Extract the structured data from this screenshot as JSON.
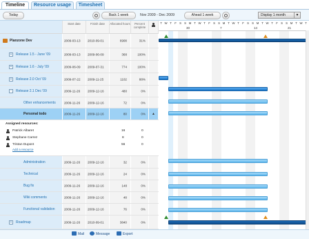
{
  "tabs": [
    {
      "label": "Timeline"
    },
    {
      "label": "Resource usage"
    },
    {
      "label": "Timesheet"
    }
  ],
  "toolbar": {
    "today": "Today",
    "back": "Back 1 week",
    "period": "Nov 2009 - Dec 2009",
    "ahead": "Ahead 1 week",
    "display": "Display 1 month"
  },
  "headers": {
    "start": "Start date",
    "finish": "Finish date",
    "allocated": "Allocated hours",
    "percent": "Percent complete"
  },
  "timeline": {
    "days": [
      "T",
      "W",
      "T",
      "F",
      "S",
      "S",
      "M",
      "T",
      "W",
      "T",
      "F",
      "S",
      "S",
      "M",
      "T",
      "W",
      "T",
      "F",
      "S",
      "S",
      "M",
      "T",
      "W",
      "T",
      "F",
      "S",
      "S",
      "M",
      "T",
      "W",
      "T"
    ],
    "weeks": [
      "30",
      "7",
      "14",
      "21"
    ]
  },
  "rows": [
    {
      "name": "Planzone Dev",
      "start": "2009-03-13",
      "finish": "2010-09-01",
      "hours": "6908",
      "pct": "31%"
    },
    {
      "name": "Release 1.5 - June '09",
      "start": "2009-03-13",
      "finish": "2009-06-09",
      "hours": "368",
      "pct": "100%"
    },
    {
      "name": "Release 1.6 - July '09",
      "start": "2009-06-09",
      "finish": "2009-07-31",
      "hours": "774",
      "pct": "100%"
    },
    {
      "name": "Release 2.0 Oct '09",
      "start": "2009-07-22",
      "finish": "2009-11-25",
      "hours": "1102",
      "pct": "88%"
    },
    {
      "name": "Release 2.1 Dec '09",
      "start": "2009-11-26",
      "finish": "2009-12-16",
      "hours": "480",
      "pct": "0%"
    },
    {
      "name": "Other enhancements",
      "start": "2009-11-26",
      "finish": "2009-12-16",
      "hours": "72",
      "pct": "0%"
    },
    {
      "name": "Personal todo",
      "start": "2009-11-26",
      "finish": "2009-12-16",
      "hours": "80",
      "pct": "0%"
    }
  ],
  "assigned": {
    "title": "Assigned resources:",
    "people": [
      {
        "name": "Patrick Albaret",
        "hours": "16",
        "pct": "0"
      },
      {
        "name": "Stephane Carrez",
        "hours": "8",
        "pct": "0"
      },
      {
        "name": "Tristan Dupont",
        "hours": "56",
        "pct": "0"
      }
    ],
    "add": "Add a resource"
  },
  "tasks": [
    {
      "name": "Administration",
      "start": "2009-11-26",
      "finish": "2009-12-16",
      "hours": "32",
      "pct": "0%"
    },
    {
      "name": "Technical",
      "start": "2009-11-26",
      "finish": "2009-12-16",
      "hours": "24",
      "pct": "0%"
    },
    {
      "name": "Bug fix",
      "start": "2009-11-26",
      "finish": "2009-12-16",
      "hours": "148",
      "pct": "0%"
    },
    {
      "name": "Wiki comments",
      "start": "2009-11-26",
      "finish": "2009-12-16",
      "hours": "48",
      "pct": "0%"
    },
    {
      "name": "Functional validation",
      "start": "2009-11-26",
      "finish": "2009-12-16",
      "hours": "76",
      "pct": "0%"
    },
    {
      "name": "Roadmap",
      "start": "2009-11-26",
      "finish": "2010-09-01",
      "hours": "3840",
      "pct": "0%"
    }
  ],
  "footer": {
    "mail": "Mail",
    "message": "Message",
    "export": "Export"
  }
}
